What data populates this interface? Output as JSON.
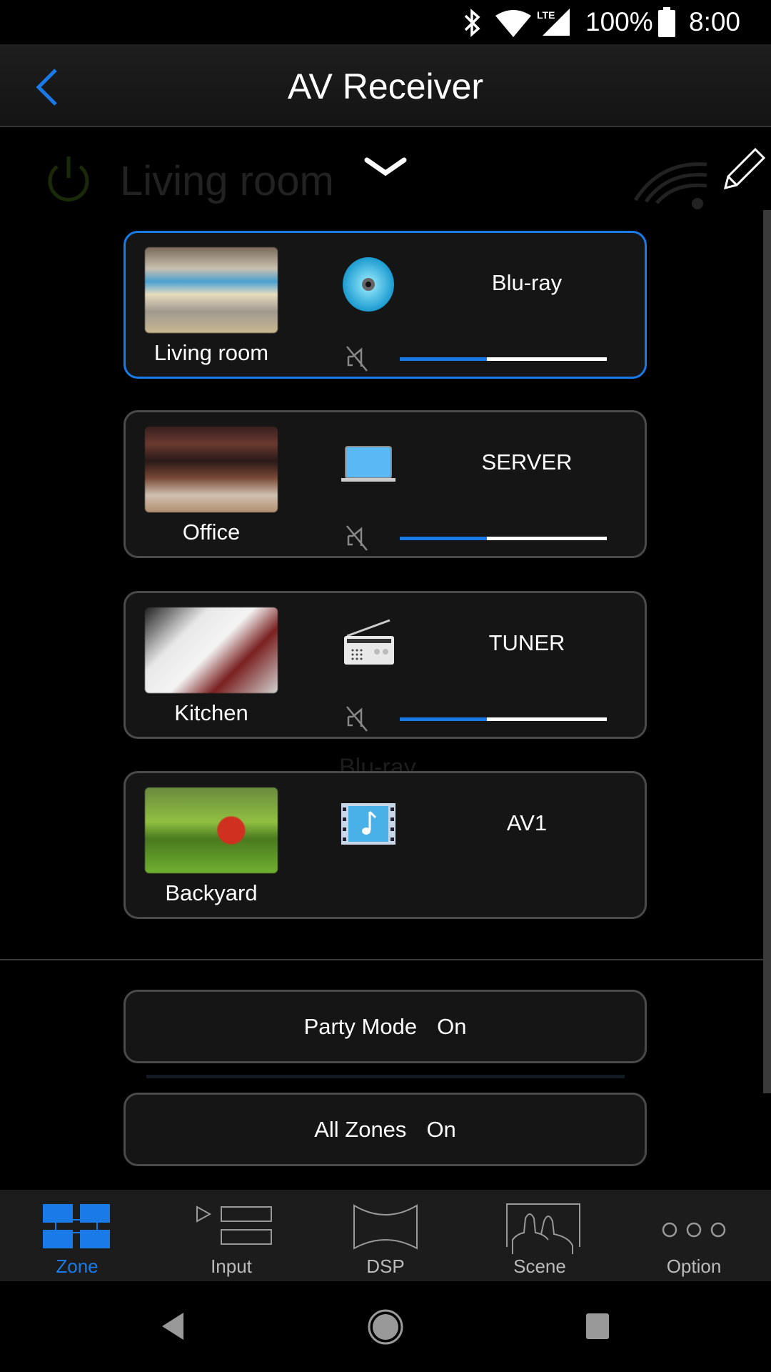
{
  "status_bar": {
    "battery": "100%",
    "time": "8:00",
    "network": "LTE",
    "icons": [
      "bluetooth-icon",
      "wifi-icon",
      "signal-icon",
      "battery-icon"
    ]
  },
  "header": {
    "title": "AV Receiver",
    "back_icon": "chevron-left-icon"
  },
  "background": {
    "zone_name": "Living room",
    "source": "Blu-ray"
  },
  "zones": [
    {
      "name": "Living room",
      "source": "Blu-ray",
      "source_icon": "disc-icon",
      "volume_percent": 42,
      "muted": true,
      "selected": true
    },
    {
      "name": "Office",
      "source": "SERVER",
      "source_icon": "laptop-icon",
      "volume_percent": 42,
      "muted": true,
      "selected": false
    },
    {
      "name": "Kitchen",
      "source": "TUNER",
      "source_icon": "radio-icon",
      "volume_percent": 42,
      "muted": true,
      "selected": false
    },
    {
      "name": "Backyard",
      "source": "AV1",
      "source_icon": "film-music-icon",
      "selected": false
    }
  ],
  "party_mode": {
    "label": "Party Mode",
    "value": "On"
  },
  "all_zones": {
    "label": "All Zones",
    "value": "On"
  },
  "bottom_nav": [
    {
      "label": "Zone",
      "active": true
    },
    {
      "label": "Input"
    },
    {
      "label": "DSP"
    },
    {
      "label": "Scene"
    },
    {
      "label": "Option"
    }
  ],
  "colors": {
    "accent": "#1a7be8",
    "card_bg": "#151515",
    "card_border": "#4a4a4a"
  }
}
